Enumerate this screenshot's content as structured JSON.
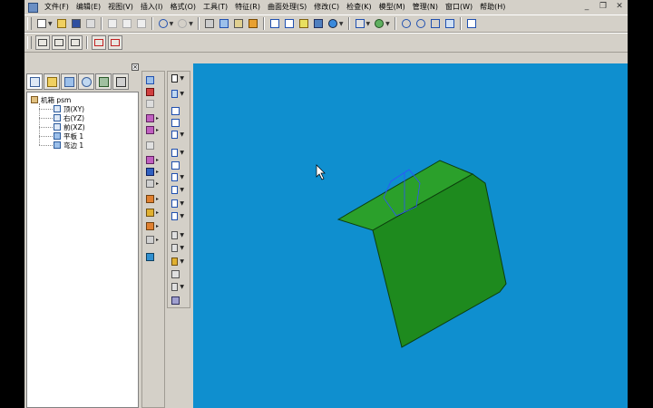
{
  "menu": {
    "items": [
      "文件(F)",
      "编辑(E)",
      "视图(V)",
      "插入(I)",
      "格式(O)",
      "工具(T)",
      "特征(R)",
      "曲面处理(S)",
      "修改(C)",
      "检查(K)",
      "模型(M)",
      "管理(N)",
      "窗口(W)",
      "帮助(H)"
    ]
  },
  "window_controls": {
    "minimize": "_",
    "restore": "❐",
    "close": "✕"
  },
  "model_tree": {
    "close_label": "×",
    "root": "机箱 psm",
    "items": [
      "顶(XY)",
      "右(YZ)",
      "前(XZ)",
      "平板 1",
      "弯边 1"
    ]
  },
  "colors": {
    "viewport_bg": "#0f8fcf",
    "part_face": "#1e8a1e",
    "part_face_light": "#2ba02b",
    "part_edge": "#0c3d0c",
    "ui_face": "#d4d0c8"
  },
  "icons": {
    "toolbar": [
      "new-icon",
      "open-icon",
      "save-icon",
      "print-icon",
      "cut-icon",
      "copy-icon",
      "paste-icon",
      "undo-icon",
      "redo-icon",
      "select-icon",
      "view-icon",
      "zoom-icon",
      "help-icon"
    ]
  }
}
